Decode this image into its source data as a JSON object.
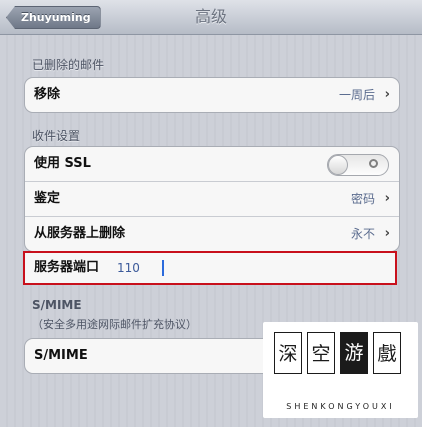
{
  "navbar": {
    "back_label": "Zhuyuming",
    "title": "高级"
  },
  "deleted_section": {
    "header": "已删除的邮件",
    "move_row": {
      "label": "移除",
      "value": "一周后"
    }
  },
  "incoming_section": {
    "header": "收件设置",
    "ssl_row": {
      "label": "使用 SSL",
      "toggle_on": false
    },
    "auth_row": {
      "label": "鉴定",
      "value": "密码"
    },
    "delete_row": {
      "label": "从服务器上删除",
      "value": "永不"
    },
    "port_row": {
      "label": "服务器端口",
      "value": "110"
    }
  },
  "smime_section": {
    "header": "S/MIME",
    "description": "（安全多用途网际邮件扩充协议）",
    "row": {
      "label": "S/MIME"
    }
  },
  "watermark": {
    "chars": [
      "深",
      "空",
      "游",
      "戲"
    ],
    "subtitle": "SHENKONGYOUXI"
  },
  "icons": {
    "chevron": "›",
    "back": "chevron-left"
  },
  "colors": {
    "highlight_border": "#c8101c",
    "value_text": "#5a6b8e"
  }
}
